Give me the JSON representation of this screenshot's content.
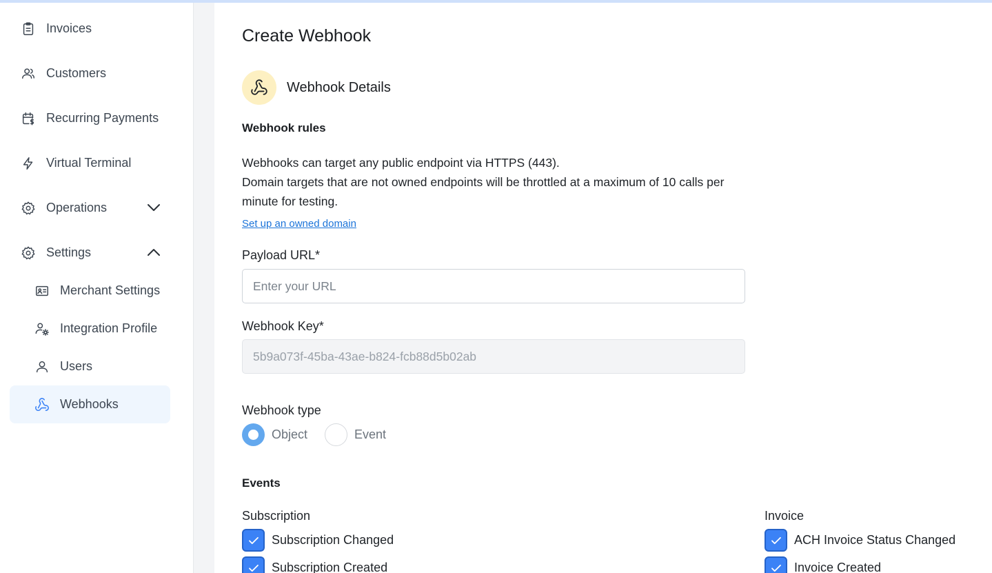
{
  "sidebar": {
    "items": [
      {
        "label": "Invoices"
      },
      {
        "label": "Customers"
      },
      {
        "label": "Recurring Payments"
      },
      {
        "label": "Virtual Terminal"
      },
      {
        "label": "Operations"
      },
      {
        "label": "Settings"
      },
      {
        "label": "Merchant Settings"
      },
      {
        "label": "Integration Profile"
      },
      {
        "label": "Users"
      },
      {
        "label": "Webhooks"
      }
    ]
  },
  "main": {
    "title": "Create Webhook",
    "section_title": "Webhook Details",
    "rules": {
      "title": "Webhook rules",
      "line1": "Webhooks can target any public endpoint via HTTPS (443).",
      "line2": "Domain targets that are not owned endpoints will be throttled at a maximum of 10 calls per minute for testing.",
      "link": "Set up an owned domain"
    },
    "payload_url": {
      "label": "Payload URL*",
      "placeholder": "Enter your URL",
      "value": ""
    },
    "webhook_key": {
      "label": "Webhook Key*",
      "value": "5b9a073f-45ba-43ae-b824-fcb88d5b02ab"
    },
    "webhook_type": {
      "label": "Webhook type",
      "options": [
        {
          "label": "Object",
          "selected": true
        },
        {
          "label": "Event",
          "selected": false
        }
      ]
    },
    "events": {
      "title": "Events",
      "groups": [
        {
          "title": "Subscription",
          "items": [
            {
              "label": "Subscription Changed",
              "checked": true
            },
            {
              "label": "Subscription Created",
              "checked": true
            }
          ]
        },
        {
          "title": "Invoice",
          "items": [
            {
              "label": "ACH Invoice Status Changed",
              "checked": true
            },
            {
              "label": "Invoice Created",
              "checked": true
            }
          ]
        }
      ]
    }
  },
  "colors": {
    "accent": "#3b82f6",
    "active_nav_bg": "#eff6fe",
    "icon_badge_bg": "#fdf0c2",
    "link": "#1a73d9"
  }
}
